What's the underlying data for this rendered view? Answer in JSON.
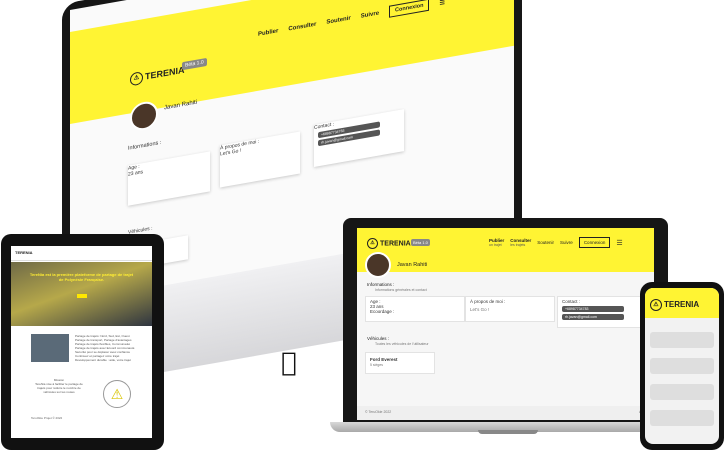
{
  "brand": {
    "name": "TERENIA",
    "version_badge": "Béta 1.0"
  },
  "nav": {
    "publier": {
      "label": "Publier",
      "sub": "un trajet"
    },
    "consulter": {
      "label": "Consulter",
      "sub": "les trajets"
    },
    "soutenir": "Soutenir",
    "suivre": "Suivre",
    "connect": "Connexion",
    "menu_icon": "hamburger-icon"
  },
  "profile": {
    "name": "Javan Rahiti",
    "info_title": "Informations :",
    "info_sub": "Informations générales et contact",
    "age_label": "Age :",
    "age_value": "23 ans",
    "overdrive_label": "Ecoordage :",
    "about_label": "À propos de moi :",
    "about_value": "Let's Go !",
    "contact_label": "Contact :",
    "phone": "+68987734783",
    "email": "rh.javan@gmail.com"
  },
  "vehicles": {
    "title": "Véhicules :",
    "sub": "Toutes les véhicules de l'utilisateur",
    "car": "Ford Everest",
    "car_sub": "5 sièges"
  },
  "footer": {
    "copyright": "© TeruOkie 2022",
    "help": "Aide"
  },
  "tablet": {
    "hero_text": "TereNia est la première plateforme de partage de trajet de Polynésie Française.",
    "lines": [
      "Partage de trajets: Nord, Sud, Est, Ouest",
      "Partage de transport, Partage d'avantages",
      "Partage de trajets flexibles, Communauté",
      "Partage de trajets avec Ecoord communauté",
      "Sécurité pour se déplacer avec confiance",
      "Continuez et partagez votre trajet",
      "Développement durable : aide, votre trajet"
    ],
    "sub_title": "Mission",
    "sub_text": "TereNia vise à faciliter le partage de trajets pour réduire le nombre de véhicules sur les routes",
    "footer": "TeruOkie Projet © 2022"
  }
}
